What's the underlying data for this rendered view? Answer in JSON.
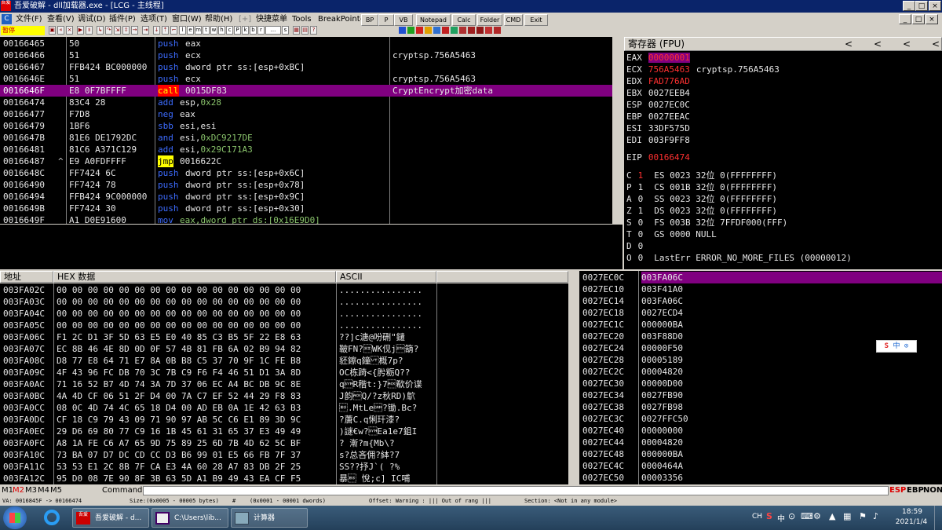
{
  "window": {
    "title": "吾爱破解 - dll加载器.exe - [LCG - 主线程]",
    "controls": [
      "_",
      "□",
      "×"
    ],
    "inner_controls": [
      "_",
      "□",
      "×"
    ]
  },
  "menu": {
    "items": [
      "文件(F)",
      "查看(V)",
      "调试(D)",
      "插件(P)",
      "选项(T)",
      "窗口(W)",
      "帮助(H)",
      "[+]",
      "快捷菜单",
      "Tools",
      "BreakPoint->"
    ]
  },
  "plugin_buttons": [
    "BP",
    "P",
    "VB",
    "Notepad",
    "Calc",
    "Folder",
    "CMD",
    "Exit"
  ],
  "toolbar": {
    "state": "暂停",
    "letters": [
      "l",
      "e",
      "m",
      "t",
      "w",
      "h",
      "c",
      "P",
      "k",
      "b",
      "r",
      "...",
      "s"
    ]
  },
  "disasm": {
    "rows": [
      {
        "addr": "00166465",
        "hex": "50",
        "mn": "push",
        "op": "eax",
        "cmt": ""
      },
      {
        "addr": "00166466",
        "hex": "51",
        "mn": "push",
        "op": "ecx",
        "cmt": "cryptsp.756A5463"
      },
      {
        "addr": "00166467",
        "hex": "FFB424 BC000000",
        "mn": "push",
        "op": "dword ptr ss:[esp+0xBC]",
        "cmt": ""
      },
      {
        "addr": "0016646E",
        "hex": "51",
        "mn": "push",
        "op": "ecx",
        "cmt": "cryptsp.756A5463"
      },
      {
        "addr": "0016646F",
        "hex": "E8 0F7BFFFF",
        "mn": "call",
        "op": "0015DF83",
        "cmt": "CryptEncrypt加密data"
      },
      {
        "addr": "00166474",
        "hex": "83C4 28",
        "mn": "add",
        "op": "esp,0x28",
        "cmt": ""
      },
      {
        "addr": "00166477",
        "hex": "F7D8",
        "mn": "neg",
        "op": "eax",
        "cmt": ""
      },
      {
        "addr": "00166479",
        "hex": "1BF6",
        "mn": "sbb",
        "op": "esi,esi",
        "cmt": ""
      },
      {
        "addr": "0016647B",
        "hex": "81E6 DE1792DC",
        "mn": "and",
        "op": "esi,0xDC9217DE",
        "cmt": ""
      },
      {
        "addr": "00166481",
        "hex": "81C6 A371C129",
        "mn": "add",
        "op": "esi,0x29C171A3",
        "cmt": ""
      },
      {
        "addr": "00166487",
        "hex": "E9 A0FDFFFF",
        "mn": "jmp",
        "op": "0016622C",
        "cmt": ""
      },
      {
        "addr": "0016648C",
        "hex": "FF7424 6C",
        "mn": "push",
        "op": "dword ptr ss:[esp+0x6C]",
        "cmt": ""
      },
      {
        "addr": "00166490",
        "hex": "FF7424 78",
        "mn": "push",
        "op": "dword ptr ss:[esp+0x78]",
        "cmt": ""
      },
      {
        "addr": "00166494",
        "hex": "FFB424 9C000000",
        "mn": "push",
        "op": "dword ptr ss:[esp+0x9C]",
        "cmt": ""
      },
      {
        "addr": "0016649B",
        "hex": "FF7424 30",
        "mn": "push",
        "op": "dword ptr ss:[esp+0x30]",
        "cmt": ""
      },
      {
        "addr": "0016649F",
        "hex": "A1 D0E91600",
        "mn": "mov",
        "op": "eax,dword ptr ds:[0x16E9D0]",
        "cmt": ""
      }
    ],
    "jump_marker": "^"
  },
  "registers": {
    "header": "寄存器 (FPU)",
    "nav": [
      "<",
      "<",
      "<",
      "<"
    ],
    "gp": [
      {
        "name": "EAX",
        "value": "00000001",
        "note": ""
      },
      {
        "name": "ECX",
        "value": "756A5463",
        "note": "cryptsp.756A5463"
      },
      {
        "name": "EDX",
        "value": "FAD776AD",
        "note": ""
      },
      {
        "name": "EBX",
        "value": "0027EEB4",
        "note": ""
      },
      {
        "name": "ESP",
        "value": "0027EC0C",
        "note": ""
      },
      {
        "name": "EBP",
        "value": "0027EEAC",
        "note": ""
      },
      {
        "name": "ESI",
        "value": "33DF575D",
        "note": ""
      },
      {
        "name": "EDI",
        "value": "003F9FF8",
        "note": ""
      }
    ],
    "eip": {
      "name": "EIP",
      "value": "00166474"
    },
    "flags": [
      {
        "f": "C",
        "v": "1",
        "seg": "ES 0023 32位 0(FFFFFFFF)"
      },
      {
        "f": "P",
        "v": "1",
        "seg": "CS 001B 32位 0(FFFFFFFF)"
      },
      {
        "f": "A",
        "v": "0",
        "seg": "SS 0023 32位 0(FFFFFFFF)"
      },
      {
        "f": "Z",
        "v": "1",
        "seg": "DS 0023 32位 0(FFFFFFFF)"
      },
      {
        "f": "S",
        "v": "0",
        "seg": "FS 003B 32位 7FFDF000(FFF)"
      },
      {
        "f": "T",
        "v": "0",
        "seg": "GS 0000 NULL"
      },
      {
        "f": "D",
        "v": "0",
        "seg": ""
      },
      {
        "f": "O",
        "v": "0",
        "seg": "LastErr ERROR_NO_MORE_FILES (00000012)"
      }
    ]
  },
  "dump": {
    "headers": [
      "地址",
      "HEX 数据",
      "ASCII"
    ],
    "rows": [
      {
        "addr": "003FA02C",
        "hex": "00 00 00 00 00 00 00 00 00 00 00 00 00 00 00 00",
        "ascii": "................"
      },
      {
        "addr": "003FA03C",
        "hex": "00 00 00 00 00 00 00 00 00 00 00 00 00 00 00 00",
        "ascii": "................"
      },
      {
        "addr": "003FA04C",
        "hex": "00 00 00 00 00 00 00 00 00 00 00 00 00 00 00 00",
        "ascii": "................"
      },
      {
        "addr": "003FA05C",
        "hex": "00 00 00 00 00 00 00 00 00 00 00 00 00 00 00 00",
        "ascii": "................"
      },
      {
        "addr": "003FA06C",
        "hex": "F1 2C D1 3F 5D 63 E5 E0 40 85 C3 B5 5F 22 E8 63",
        "ascii": "??]c溏@吩硎\"鑓"
      },
      {
        "addr": "003FA07C",
        "hex": "EC 8B 46 4E 8D 0D 0F 57 4B 81 FB 6A 02 B9 94 82",
        "ascii": "鞁FN?\u000fWK伣j\u0002箶?"
      },
      {
        "addr": "003FA08C",
        "hex": "D8 77 E8 64 71 E7 8A 0B B8 C5 37 70 9F 1C FE B8",
        "ascii": "豾鑔q鐘\u000b概7p?"
      },
      {
        "addr": "003FA09C",
        "hex": "4F 43 96 FC DB 70 3C 7B C9 F6 F4 46 51 D1 3A 8D",
        "ascii": "OC栋踦<{肹粝Q??"
      },
      {
        "addr": "003FA0AC",
        "hex": "71 16 52 B7 4D 74 3A 7D 37 06 EC A4 BC DB 9C 8E",
        "ascii": "q\u0016R稭t:}7\u0006欷价谍"
      },
      {
        "addr": "003FA0BC",
        "hex": "4A 4D CF 06 51 2F D4 00 7A C7 EF 52 44 29 F8 83",
        "ascii": "J韵\u0006Q/?z秋RD)鴥"
      },
      {
        "addr": "003FA0CC",
        "hex": "08 0C 4D 74 4C 65 18 D4 00 AD EB 0A 1E 42 63 B3",
        "ascii": "\b.MtLe\u0018?锄.Bc?"
      },
      {
        "addr": "003FA0DC",
        "hex": "CF 18 C9 79 43 09 71 90 97 AB 5C C6 E1 89 3D 9C",
        "ascii": "?蓎C.q悧玕漆?"
      },
      {
        "addr": "003FA0EC",
        "hex": "29 D6 69 80 77 C9 16 1B 45 61 31 65 37 E3 49 49",
        "ascii": ")謎€w?\u0016Ea1e7鉏I"
      },
      {
        "addr": "003FA0FC",
        "hex": "A8 1A FE C6 A7 65 9D 75 89 25 6D 7B 4D 62 5C BF",
        "ascii": "?    漸?m{Mb\\?"
      },
      {
        "addr": "003FA10C",
        "hex": "73 BA 07 D7 DC CD CC D3 B6 99 01 E5 66 FB 7F 37",
        "ascii": "s?总吝佣?絊?7"
      },
      {
        "addr": "003FA11C",
        "hex": "53 53 E1 2C 8B 7F CA E3 4A 60 28 A7 83 DB 2F 25",
        "ascii": "SS??抒J`(   ?%"
      },
      {
        "addr": "003FA12C",
        "hex": "95 D0 08 7E 90 8F 3B 63 5D A1 B9 49 43 EA CF F5",
        "ascii": "暴\b 悅;c]  IC哺"
      }
    ]
  },
  "stack": {
    "rows": [
      {
        "addr": "0027EC0C",
        "val": "003FA06C"
      },
      {
        "addr": "0027EC10",
        "val": "003F41A0"
      },
      {
        "addr": "0027EC14",
        "val": "003FA06C"
      },
      {
        "addr": "0027EC18",
        "val": "0027ECD4"
      },
      {
        "addr": "0027EC1C",
        "val": "000000BA"
      },
      {
        "addr": "0027EC20",
        "val": "003F88D0"
      },
      {
        "addr": "0027EC24",
        "val": "00000F50"
      },
      {
        "addr": "0027EC28",
        "val": "00005189"
      },
      {
        "addr": "0027EC2C",
        "val": "00004820"
      },
      {
        "addr": "0027EC30",
        "val": "00000D00"
      },
      {
        "addr": "0027EC34",
        "val": "0027FB90"
      },
      {
        "addr": "0027EC38",
        "val": "0027FB98"
      },
      {
        "addr": "0027EC3C",
        "val": "0027FFC50"
      },
      {
        "addr": "0027EC40",
        "val": "00000000"
      },
      {
        "addr": "0027EC44",
        "val": "00004820"
      },
      {
        "addr": "0027EC48",
        "val": "000000BA"
      },
      {
        "addr": "0027EC4C",
        "val": "0000464A"
      },
      {
        "addr": "0027EC50",
        "val": "00003356"
      }
    ],
    "ime_label": "中"
  },
  "cmdbar": {
    "tabs": [
      "M1",
      "M2",
      "M3",
      "M4",
      "M5"
    ],
    "label": "Command",
    "value": "",
    "right": "ESP",
    "right2": "EBP",
    "right3": "NONE"
  },
  "statusbar": {
    "items": [
      "VA: 0016845F -> 00166474",
      "Size:(0x0005 - 00005 bytes)",
      "#",
      "(0x0001 - 00001 dwords)",
      "Offset: Warning : ||| Out of rang |||",
      "Section: <Not in any module>"
    ]
  },
  "taskbar": {
    "tasks": [
      "吾爱破解 - d...",
      "C:\\Users\\lib...",
      "计算器"
    ],
    "tray": [
      "CH",
      "S",
      "中"
    ],
    "time": "18:59",
    "date": "2021/1/4"
  },
  "colors": {
    "selection": "#800080",
    "keyword": "#3d6cff",
    "register_changed": "#ff3030",
    "titlebar": "#0a246a"
  }
}
